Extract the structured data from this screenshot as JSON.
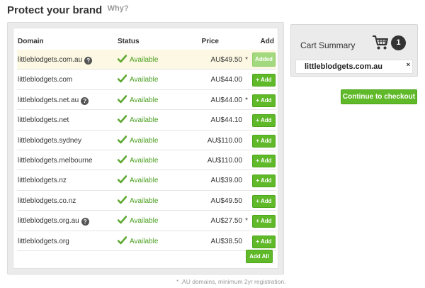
{
  "heading": {
    "title": "Protect your brand",
    "why_link": "Why?"
  },
  "table": {
    "headers": {
      "domain": "Domain",
      "status": "Status",
      "price": "Price",
      "add": "Add"
    },
    "rows": [
      {
        "domain": "littleblodgets.com.au",
        "help": true,
        "status": "Available",
        "price": "AU$49.50",
        "star": "*",
        "button": "Added",
        "added": true
      },
      {
        "domain": "littleblodgets.com",
        "help": false,
        "status": "Available",
        "price": "AU$44.00",
        "star": "",
        "button": "+ Add",
        "added": false
      },
      {
        "domain": "littleblodgets.net.au",
        "help": true,
        "status": "Available",
        "price": "AU$44.00",
        "star": "*",
        "button": "+ Add",
        "added": false
      },
      {
        "domain": "littleblodgets.net",
        "help": false,
        "status": "Available",
        "price": "AU$44.10",
        "star": "",
        "button": "+ Add",
        "added": false
      },
      {
        "domain": "littleblodgets.sydney",
        "help": false,
        "status": "Available",
        "price": "AU$110.00",
        "star": "",
        "button": "+ Add",
        "added": false
      },
      {
        "domain": "littleblodgets.melbourne",
        "help": false,
        "status": "Available",
        "price": "AU$110.00",
        "star": "",
        "button": "+ Add",
        "added": false
      },
      {
        "domain": "littleblodgets.nz",
        "help": false,
        "status": "Available",
        "price": "AU$39.00",
        "star": "",
        "button": "+ Add",
        "added": false
      },
      {
        "domain": "littleblodgets.co.nz",
        "help": false,
        "status": "Available",
        "price": "AU$49.50",
        "star": "",
        "button": "+ Add",
        "added": false
      },
      {
        "domain": "littleblodgets.org.au",
        "help": true,
        "status": "Available",
        "price": "AU$27.50",
        "star": "*",
        "button": "+ Add",
        "added": false
      },
      {
        "domain": "littleblodgets.org",
        "help": false,
        "status": "Available",
        "price": "AU$38.50",
        "star": "",
        "button": "+ Add",
        "added": false
      }
    ],
    "add_all_label": "Add All",
    "help_icon_glyph": "?"
  },
  "footnote": "* .AU domains, minimum 2yr registration.",
  "cart": {
    "title": "Cart Summary",
    "count": "1",
    "item": "littleblodgets.com.au",
    "remove_glyph": "×",
    "icon": "shopping-cart-icon"
  },
  "checkout_label": "Continue to checkout",
  "colors": {
    "accent_green": "#5fb928",
    "available_text": "#4a9e1f",
    "added_row": "#fcf8e3"
  }
}
